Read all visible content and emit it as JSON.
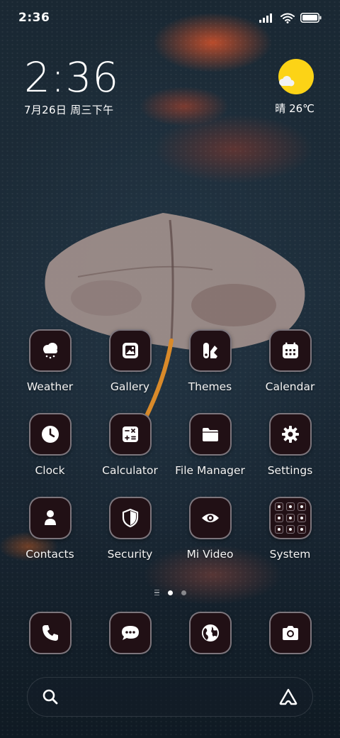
{
  "status_bar": {
    "time": "2:36",
    "icons": [
      "signal-icon",
      "wifi-icon",
      "battery-icon"
    ]
  },
  "clock_widget": {
    "time": "2:36",
    "date": "7月26日 周三下午"
  },
  "weather_widget": {
    "icon": "partly-sunny-icon",
    "text": "晴 26℃"
  },
  "apps": [
    {
      "label": "Weather",
      "icon": "cloud-rain-icon"
    },
    {
      "label": "Gallery",
      "icon": "image-icon"
    },
    {
      "label": "Themes",
      "icon": "brush-palette-icon"
    },
    {
      "label": "Calendar",
      "icon": "calendar-icon"
    },
    {
      "label": "Clock",
      "icon": "clock-icon"
    },
    {
      "label": "Calculator",
      "icon": "calculator-icon"
    },
    {
      "label": "File Manager",
      "icon": "folder-icon"
    },
    {
      "label": "Settings",
      "icon": "gear-icon"
    },
    {
      "label": "Contacts",
      "icon": "person-icon"
    },
    {
      "label": "Security",
      "icon": "shield-icon"
    },
    {
      "label": "Mi Video",
      "icon": "eye-icon"
    },
    {
      "label": "System",
      "icon": "folder-grid-icon"
    }
  ],
  "page_indicator": {
    "pages": 2,
    "active_page": 1
  },
  "dock": [
    {
      "icon": "phone-icon"
    },
    {
      "icon": "message-icon"
    },
    {
      "icon": "globe-icon"
    },
    {
      "icon": "camera-icon"
    }
  ],
  "search_bar": {
    "left_icon": "search-icon",
    "right_icon": "assistant-icon"
  },
  "colors": {
    "sun": "#fcd316",
    "icon_bg": "#211015",
    "icon_border": "#c8c8d2"
  }
}
